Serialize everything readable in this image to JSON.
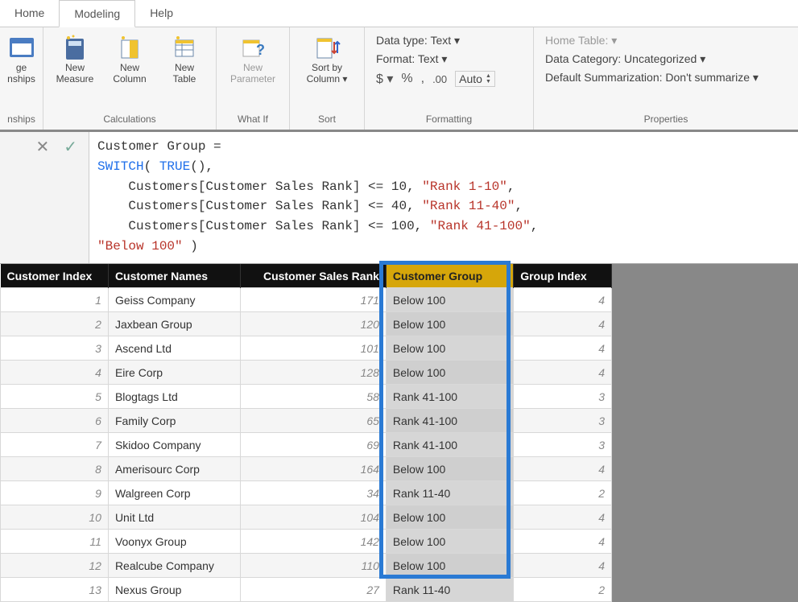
{
  "tabs": {
    "home": "Home",
    "modeling": "Modeling",
    "help": "Help",
    "active": "modeling"
  },
  "ribbon": {
    "relationships_label": "nships",
    "manage_top": "ge",
    "manage_bottom": "nships",
    "calc": {
      "measure": "New\nMeasure",
      "column": "New\nColumn",
      "table": "New\nTable",
      "label": "Calculations"
    },
    "whatif": {
      "btn": "New\nParameter",
      "label": "What If"
    },
    "sort": {
      "btn": "Sort by\nColumn ▾",
      "label": "Sort"
    },
    "formatting": {
      "datatype": "Data type: Text ▾",
      "format": "Format: Text ▾",
      "auto": "Auto",
      "label": "Formatting"
    },
    "properties": {
      "hometable": "Home Table:  ▾",
      "datacat": "Data Category: Uncategorized ▾",
      "summ": "Default Summarization: Don't summarize ▾",
      "label": "Properties"
    }
  },
  "formula": {
    "line1_a": "Customer Group =",
    "line2_a": "SWITCH",
    "line2_b": "( ",
    "line2_c": "TRUE",
    "line2_d": "(),",
    "line3_a": "    Customers[Customer Sales Rank] <= 10, ",
    "line3_b": "\"Rank 1-10\"",
    "line3_c": ",",
    "line4_a": "    Customers[Customer Sales Rank] <= 40, ",
    "line4_b": "\"Rank 11-40\"",
    "line4_c": ",",
    "line5_a": "    Customers[Customer Sales Rank] <= 100, ",
    "line5_b": "\"Rank 41-100\"",
    "line5_c": ",",
    "line6_a": "\"Below 100\"",
    "line6_b": " )"
  },
  "table": {
    "headers": {
      "idx": "Customer Index",
      "names": "Customer Names",
      "rank": "Customer Sales Rank",
      "group": "Customer Group",
      "gidx": "Group Index"
    },
    "rows": [
      {
        "idx": "1",
        "name": "Geiss Company",
        "rank": "171",
        "group": "Below 100",
        "gidx": "4"
      },
      {
        "idx": "2",
        "name": "Jaxbean Group",
        "rank": "120",
        "group": "Below 100",
        "gidx": "4"
      },
      {
        "idx": "3",
        "name": "Ascend Ltd",
        "rank": "101",
        "group": "Below 100",
        "gidx": "4"
      },
      {
        "idx": "4",
        "name": "Eire Corp",
        "rank": "128",
        "group": "Below 100",
        "gidx": "4"
      },
      {
        "idx": "5",
        "name": "Blogtags Ltd",
        "rank": "58",
        "group": "Rank 41-100",
        "gidx": "3"
      },
      {
        "idx": "6",
        "name": "Family Corp",
        "rank": "65",
        "group": "Rank 41-100",
        "gidx": "3"
      },
      {
        "idx": "7",
        "name": "Skidoo Company",
        "rank": "69",
        "group": "Rank 41-100",
        "gidx": "3"
      },
      {
        "idx": "8",
        "name": "Amerisourc Corp",
        "rank": "164",
        "group": "Below 100",
        "gidx": "4"
      },
      {
        "idx": "9",
        "name": "Walgreen Corp",
        "rank": "34",
        "group": "Rank 11-40",
        "gidx": "2"
      },
      {
        "idx": "10",
        "name": "Unit Ltd",
        "rank": "104",
        "group": "Below 100",
        "gidx": "4"
      },
      {
        "idx": "11",
        "name": "Voonyx Group",
        "rank": "142",
        "group": "Below 100",
        "gidx": "4"
      },
      {
        "idx": "12",
        "name": "Realcube Company",
        "rank": "110",
        "group": "Below 100",
        "gidx": "4"
      },
      {
        "idx": "13",
        "name": "Nexus Group",
        "rank": "27",
        "group": "Rank 11-40",
        "gidx": "2"
      }
    ]
  }
}
